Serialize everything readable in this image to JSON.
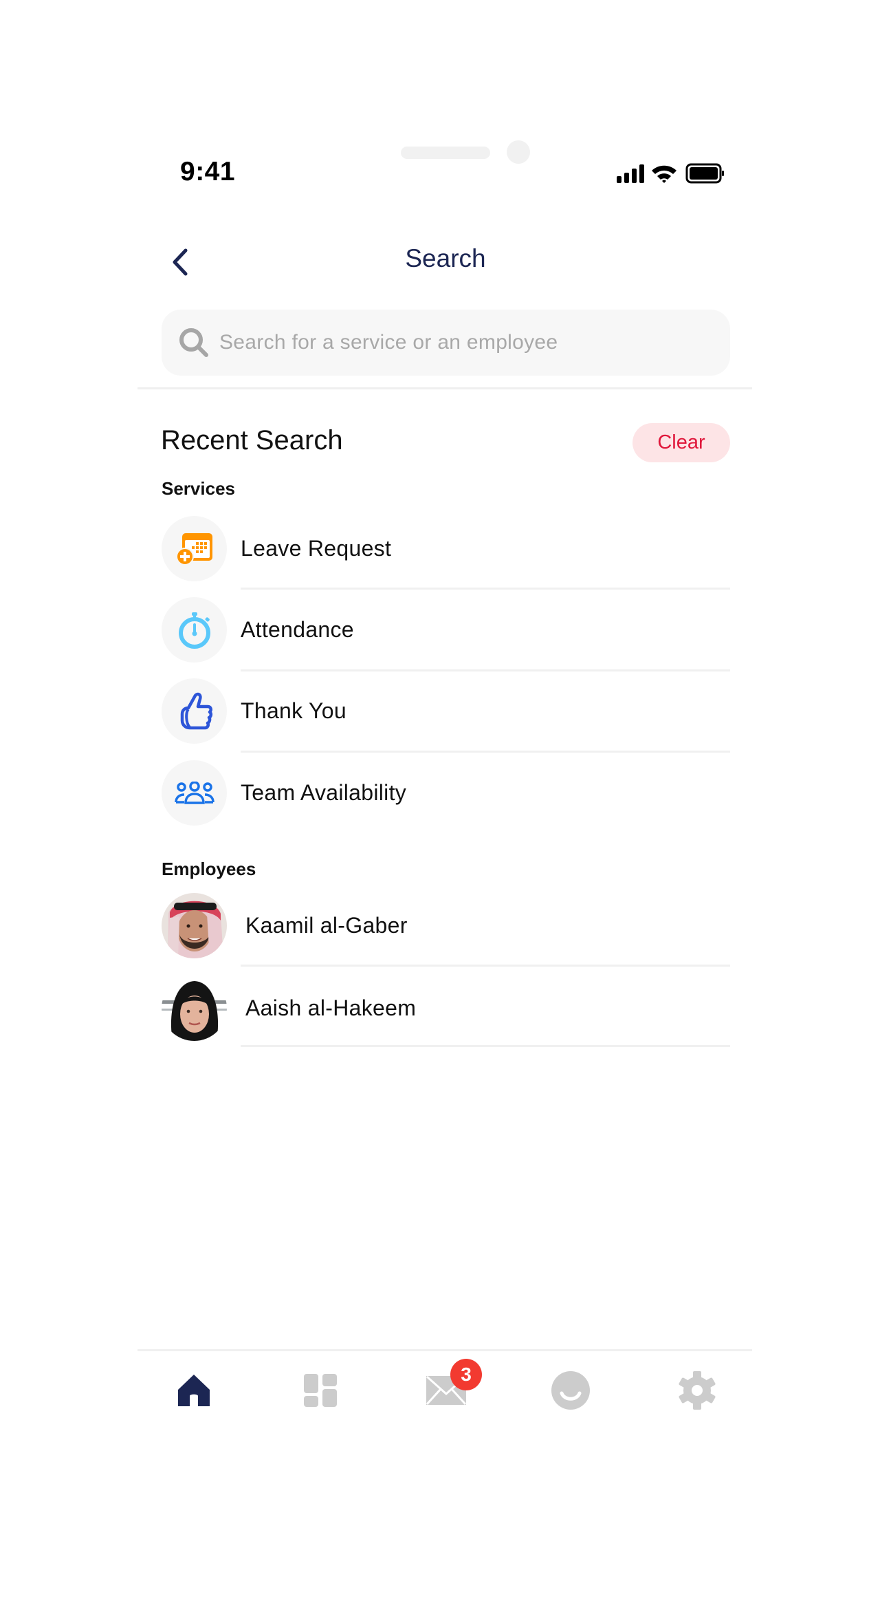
{
  "status_bar": {
    "time": "9:41",
    "icons": [
      "cellular-signal-icon",
      "wifi-icon",
      "battery-icon"
    ]
  },
  "header": {
    "title": "Search",
    "back_icon": "chevron-left-icon"
  },
  "search": {
    "placeholder": "Search for a service or an employee",
    "value": "",
    "icon": "search-icon"
  },
  "recent": {
    "title": "Recent Search",
    "clear_label": "Clear",
    "services_label": "Services",
    "services": [
      {
        "label": "Leave Request",
        "icon": "calendar-add-icon",
        "color": "#FF9500"
      },
      {
        "label": "Attendance",
        "icon": "stopwatch-icon",
        "color": "#5AC8FA"
      },
      {
        "label": "Thank You",
        "icon": "thumbs-up-icon",
        "color": "#2D55D8"
      },
      {
        "label": "Team Availability",
        "icon": "team-icon",
        "color": "#1A73E8"
      }
    ],
    "employees_label": "Employees",
    "employees": [
      {
        "name": "Kaamil al-Gaber",
        "avatar": "avatar-photo"
      },
      {
        "name": "Aaish al-Hakeem",
        "avatar": "avatar-photo"
      }
    ]
  },
  "bottom_nav": {
    "items": [
      {
        "name": "home",
        "icon": "home-icon",
        "active": true
      },
      {
        "name": "dashboard",
        "icon": "grid-icon",
        "active": false
      },
      {
        "name": "messages",
        "icon": "mail-icon",
        "active": false,
        "badge": "3"
      },
      {
        "name": "profile",
        "icon": "smiley-icon",
        "active": false
      },
      {
        "name": "settings",
        "icon": "gear-icon",
        "active": false
      }
    ],
    "active_color": "#1C2653",
    "inactive_color": "#CCCCCC",
    "badge_color": "#F23A30"
  },
  "colors": {
    "title": "#1C2653",
    "clear_bg": "#FDE4E6",
    "clear_text": "#E0173B",
    "search_bg": "#F7F7F7"
  }
}
